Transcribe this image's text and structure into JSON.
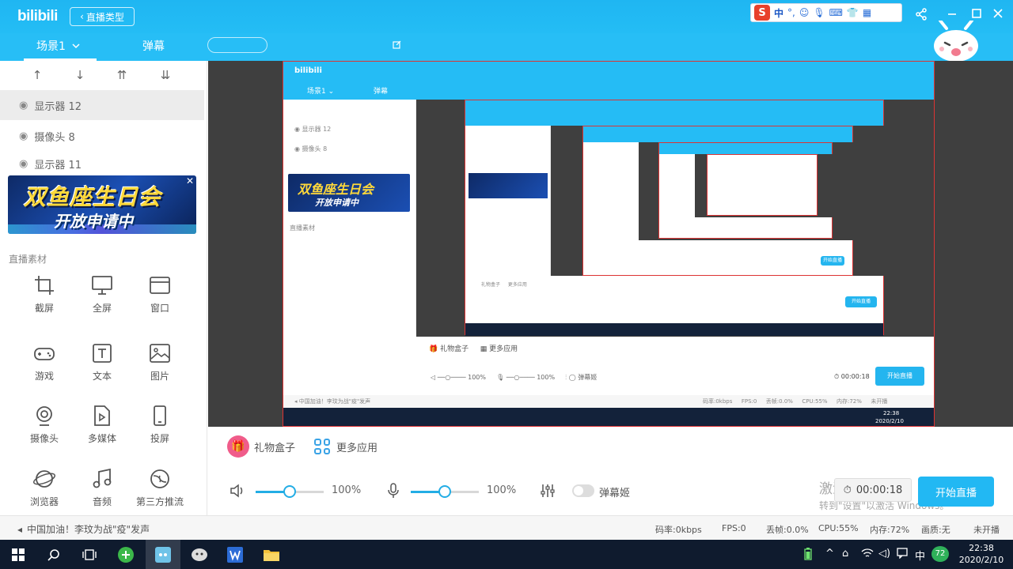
{
  "app": {
    "logo": "bilibili",
    "live_type_label": "直播类型"
  },
  "ime": {
    "logo": "S",
    "lang": "中",
    "glyphs": [
      "°,",
      "☺",
      "🎙",
      "⌨",
      "👕",
      "▦"
    ]
  },
  "tabs": {
    "scene": "场景1",
    "danmaku": "弹幕"
  },
  "sources": [
    {
      "label": "显示器 12",
      "selected": true
    },
    {
      "label": "摄像头 8",
      "selected": false
    },
    {
      "label": "显示器 11",
      "selected": false
    }
  ],
  "banner": {
    "line1": "双鱼座生日会",
    "line2": "开放申请中"
  },
  "materials": {
    "title": "直播素材",
    "items": [
      {
        "label": "截屏",
        "icon": "crop-icon"
      },
      {
        "label": "全屏",
        "icon": "monitor-icon"
      },
      {
        "label": "窗口",
        "icon": "window-icon"
      },
      {
        "label": "游戏",
        "icon": "gamepad-icon"
      },
      {
        "label": "文本",
        "icon": "text-icon"
      },
      {
        "label": "图片",
        "icon": "image-icon"
      },
      {
        "label": "摄像头",
        "icon": "camera-icon"
      },
      {
        "label": "多媒体",
        "icon": "media-icon"
      },
      {
        "label": "投屏",
        "icon": "phone-icon"
      },
      {
        "label": "浏览器",
        "icon": "browser-icon"
      },
      {
        "label": "音频",
        "icon": "music-icon"
      },
      {
        "label": "第三方推流",
        "icon": "stream-icon"
      }
    ]
  },
  "controls": {
    "gift_box": "礼物盒子",
    "more_apps": "更多应用",
    "speaker_volume": "100%",
    "speaker_level": 0.5,
    "mic_volume": "100%",
    "mic_level": 0.5,
    "danmaku_toggle": "弹幕姬",
    "timer": "00:00:18",
    "start_live": "开始直播",
    "activate_line1": "激活 Windows",
    "activate_line2": "转到\"设置\"以激活 Windows。"
  },
  "status": {
    "news": "中国加油！李玟为战\"疫\"发声",
    "bitrate": "码率:0kbps",
    "fps": "FPS:0",
    "dropped": "丢帧:0.0%",
    "cpu": "CPU:55%",
    "memory": "内存:72%",
    "quality": "画质:无",
    "live_state": "未开播"
  },
  "taskbar": {
    "tray_lang": "中",
    "tray_badge": "72",
    "time": "22:38",
    "date": "2020/2/10"
  },
  "colors": {
    "brand": "#23b9f3",
    "start_button": "#22b8f3",
    "taskbar": "#0f1b2e"
  }
}
